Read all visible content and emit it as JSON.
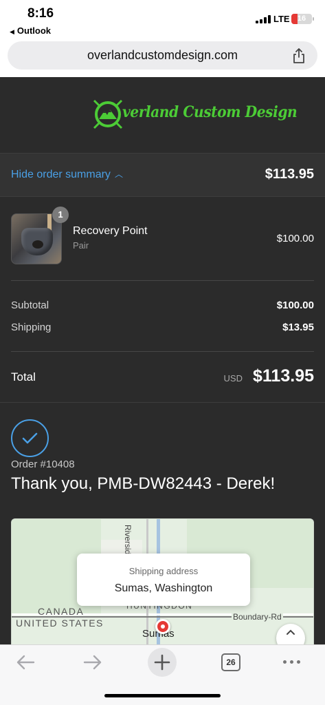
{
  "status_bar": {
    "time": "8:16",
    "back_app": "Outlook",
    "network": "LTE",
    "battery": "16",
    "battery_color": "#e53935"
  },
  "browser": {
    "url": "overlandcustomdesign.com",
    "share_icon": "share-icon",
    "tab_count": "26"
  },
  "header": {
    "logo_text": "verland Custom Design",
    "logo_color": "#4ccc36"
  },
  "order_summary": {
    "toggle_label": "Hide order summary",
    "total": "$113.95",
    "link_color": "#4aa0e6"
  },
  "line_item": {
    "quantity": "1",
    "name": "Recovery Point",
    "variant": "Pair",
    "price": "$100.00"
  },
  "totals": {
    "subtotal_label": "Subtotal",
    "subtotal_value": "$100.00",
    "shipping_label": "Shipping",
    "shipping_value": "$13.95",
    "total_label": "Total",
    "total_currency": "USD",
    "total_value": "$113.95"
  },
  "confirmation": {
    "order_number": "Order #10408",
    "thank_you": "Thank you, PMB-DW82443 - Derek!"
  },
  "map": {
    "label_canada": "CANADA",
    "label_us": "UNITED STATES",
    "label_huntingdon": "HUNTINGDON",
    "label_boundary": "Boundary-Rd",
    "label_riverside": "Riverside",
    "label_sumas": "Sumas",
    "tooltip_label": "Shipping address",
    "tooltip_value": "Sumas, Washington"
  }
}
